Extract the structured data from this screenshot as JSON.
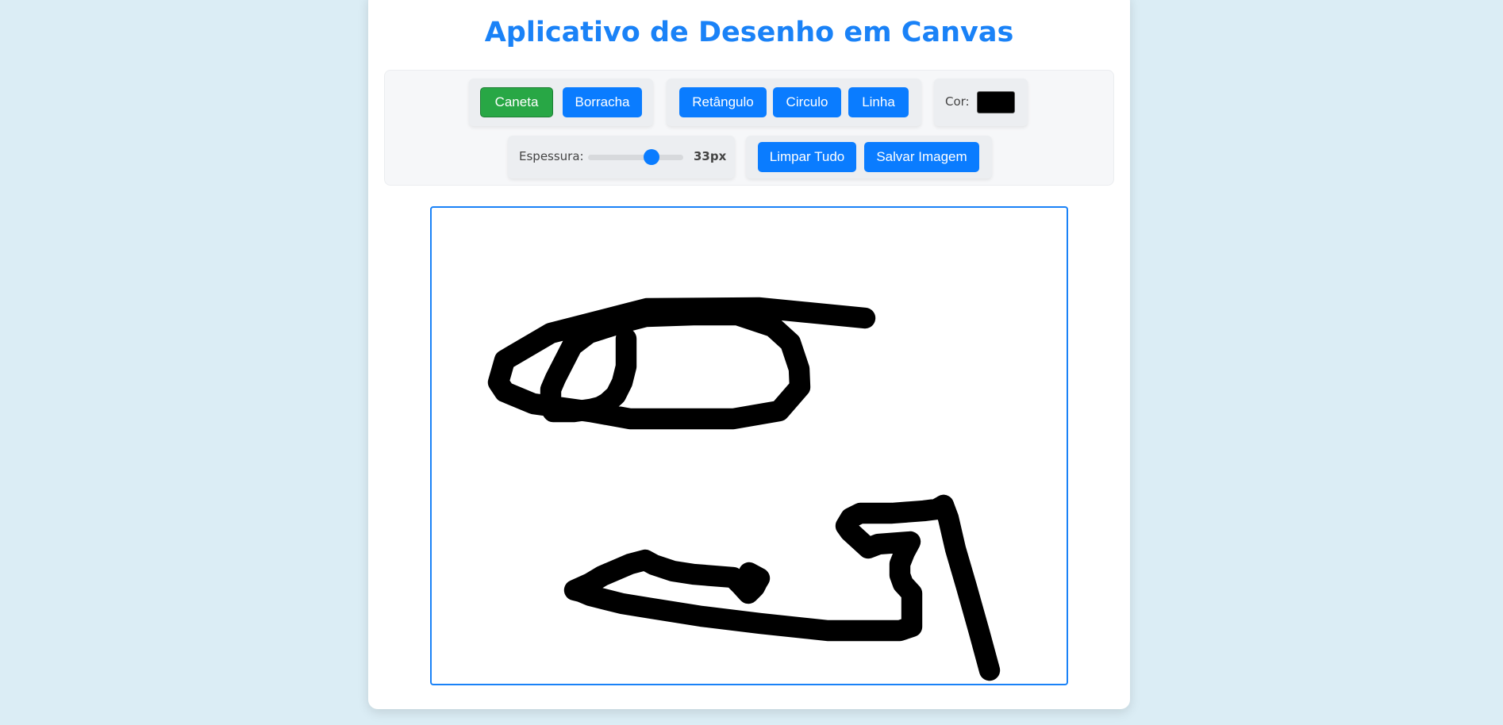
{
  "page": {
    "title": "Aplicativo de Desenho em Canvas"
  },
  "toolbar": {
    "tools": {
      "pen_label": "Caneta",
      "eraser_label": "Borracha",
      "active": "Caneta"
    },
    "shapes": {
      "rectangle_label": "Retângulo",
      "circle_label": "Circulo",
      "line_label": "Linha"
    },
    "color": {
      "label": "Cor:",
      "value": "#000000"
    },
    "thickness": {
      "label": "Espessura:",
      "value": 33,
      "min": 1,
      "max": 50,
      "display": "33px"
    },
    "actions": {
      "clear_label": "Limpar Tudo",
      "save_label": "Salvar Imagem"
    }
  },
  "canvas": {
    "stroke_color": "#000000",
    "stroke_width": 33
  },
  "colors": {
    "accent": "#0a7cff",
    "active_tool": "#28a745",
    "background": "#dbedf5"
  }
}
